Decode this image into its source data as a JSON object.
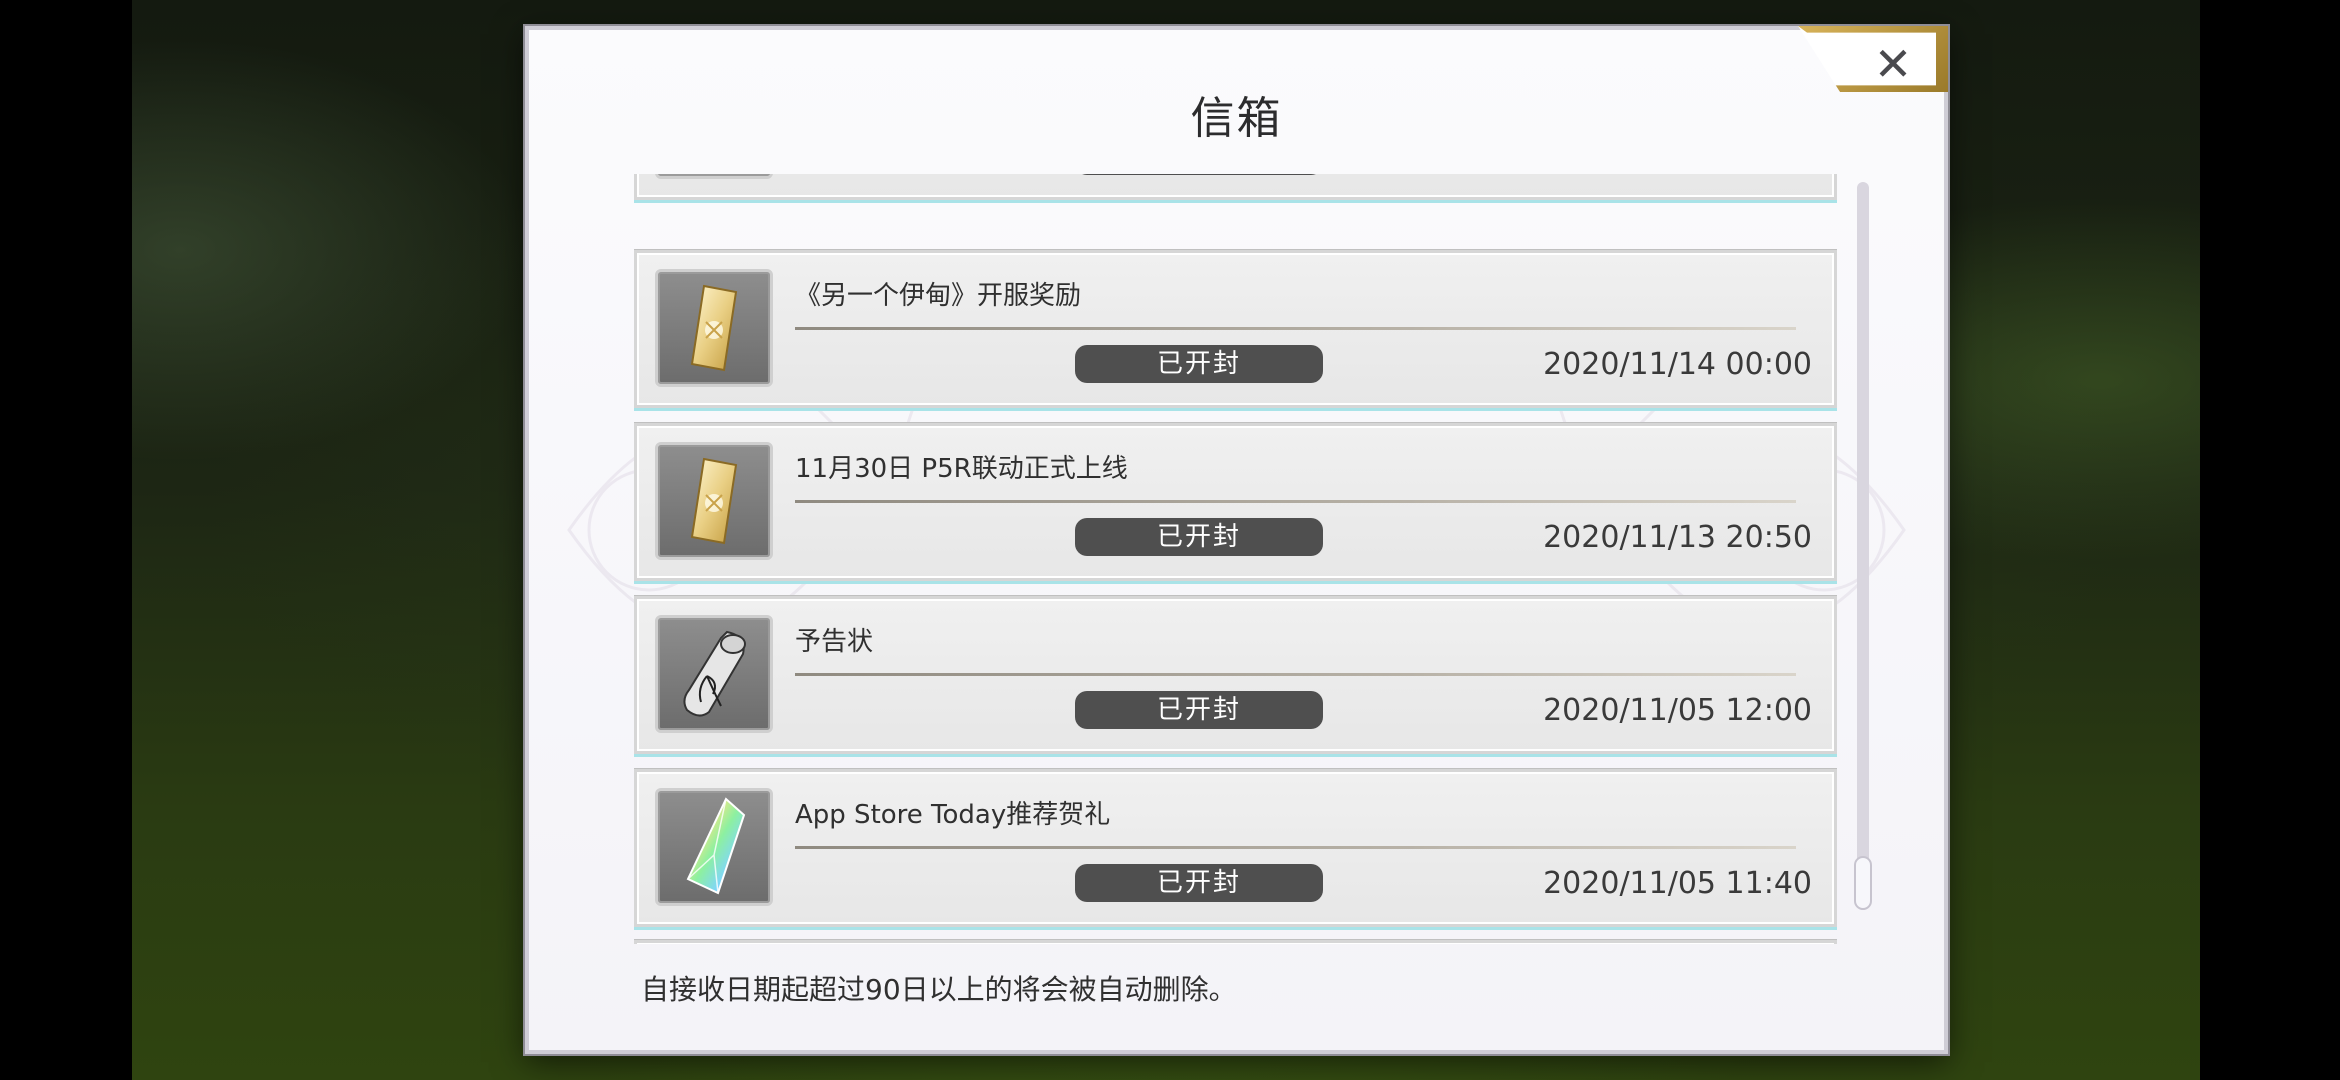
{
  "dialog": {
    "title": "信箱",
    "close_icon": "close-x-icon",
    "footer_note": "自接收日期起超过90日以上的将会被自动删除。"
  },
  "mail": {
    "items": [
      {
        "title": "《另一个伊甸》开服奖励",
        "status": "已开封",
        "date": "2020/11/14 00:00",
        "icon": "gold-ticket-icon"
      },
      {
        "title": "11月30日 P5R联动正式上线",
        "status": "已开封",
        "date": "2020/11/13 20:50",
        "icon": "gold-ticket-icon"
      },
      {
        "title": "予告状",
        "status": "已开封",
        "date": "2020/11/05 12:00",
        "icon": "scroll-letter-icon"
      },
      {
        "title": "App Store Today推荐贺礼",
        "status": "已开封",
        "date": "2020/11/05 11:40",
        "icon": "rainbow-crystal-icon"
      }
    ]
  },
  "colors": {
    "dialog_bg": "#f7f6fa",
    "status_badge": "#4f4f4f",
    "accent_gold": "#c9a24a",
    "item_underline": "#a9e3e8"
  }
}
